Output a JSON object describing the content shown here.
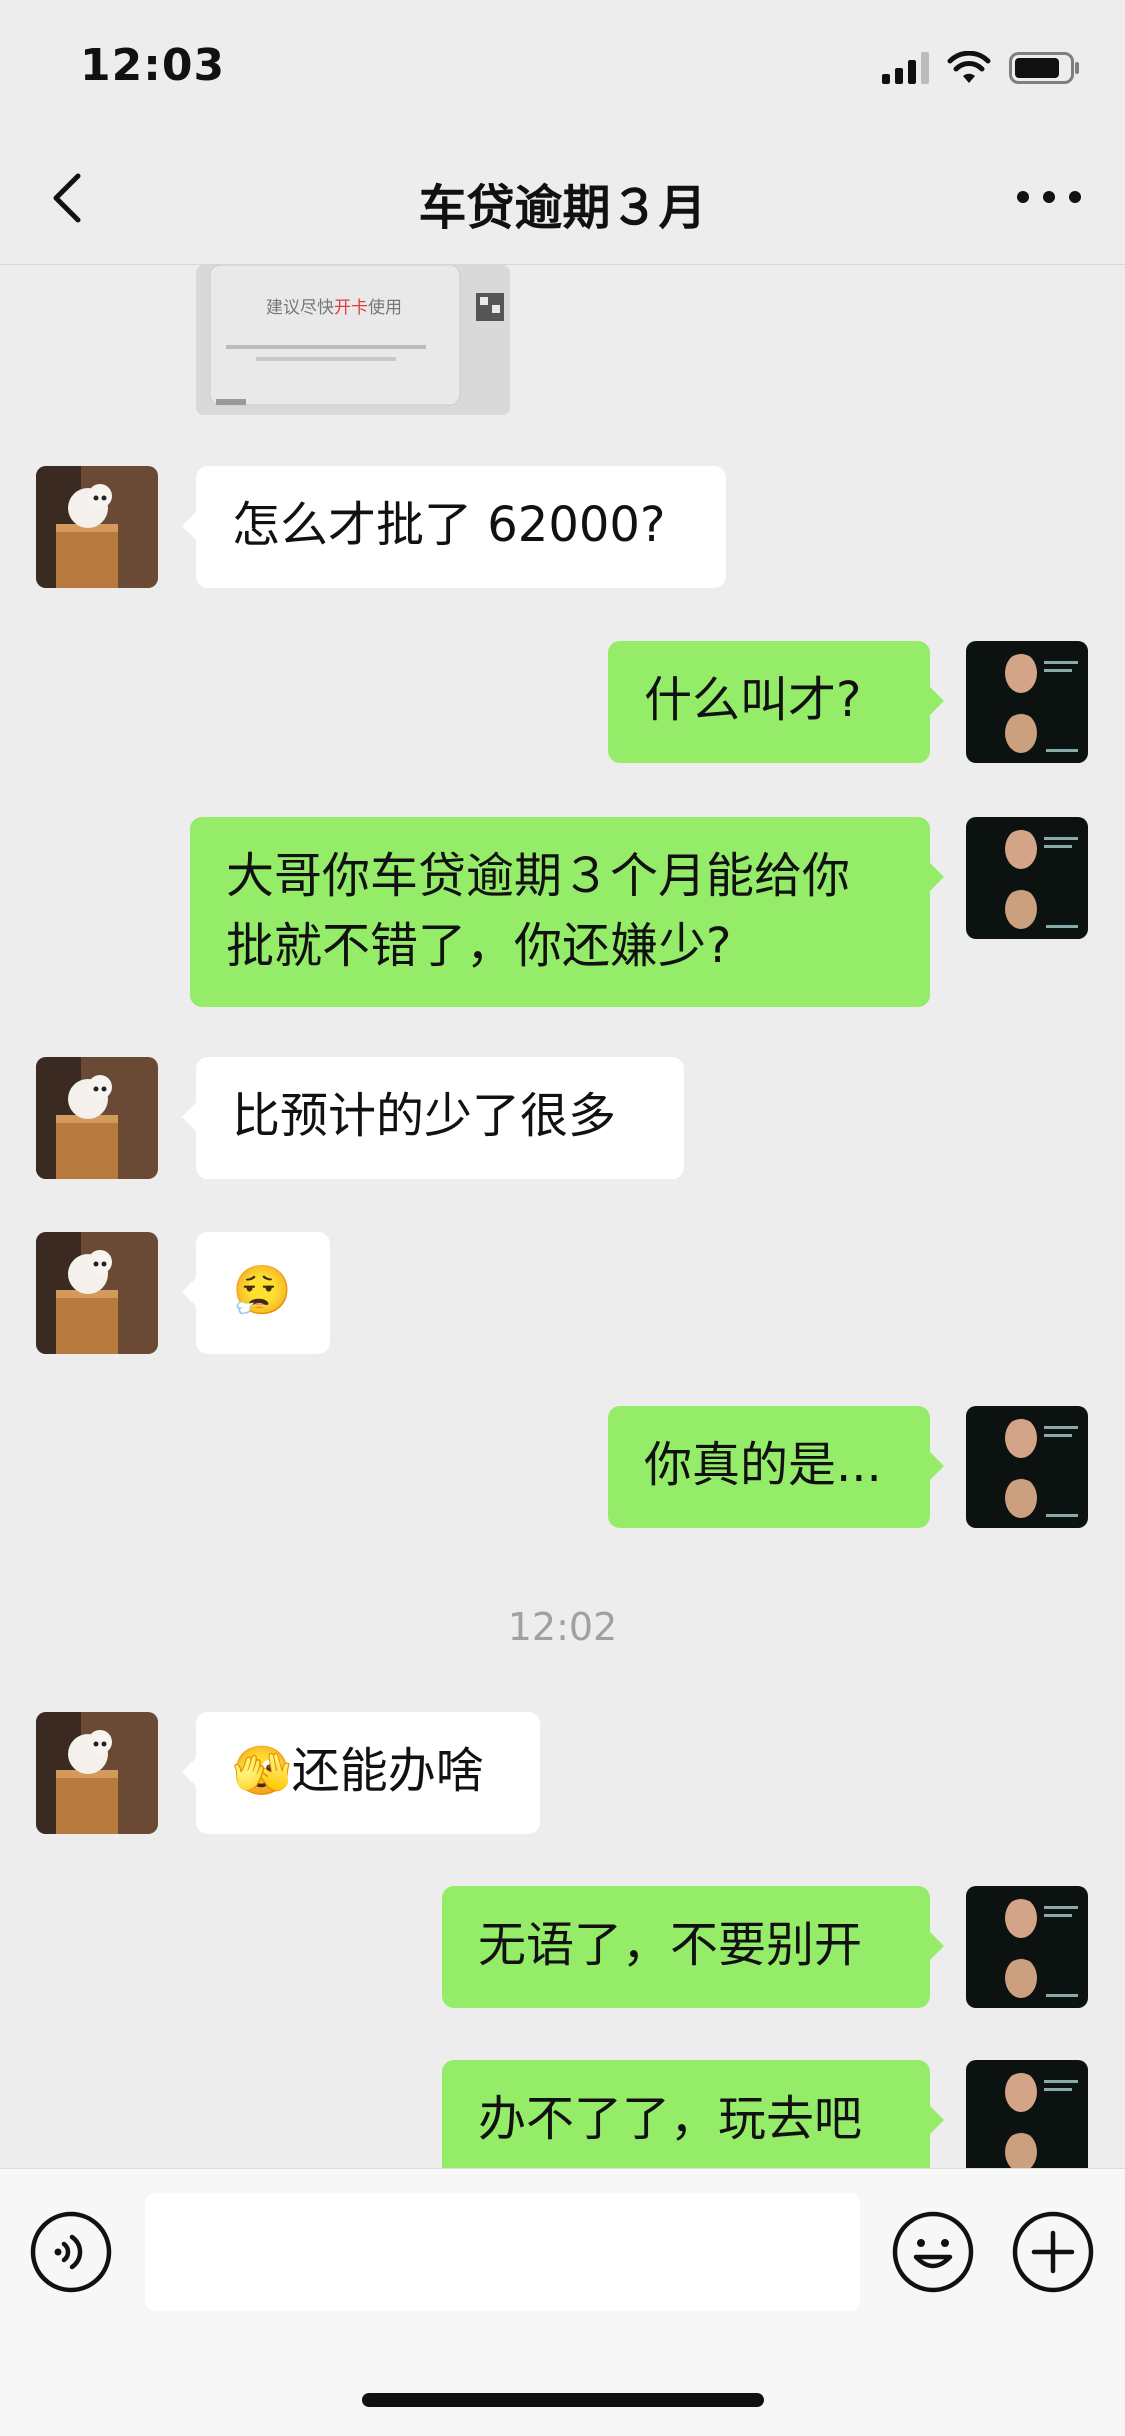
{
  "status": {
    "time": "12:03"
  },
  "nav": {
    "title": "车贷逾期３月"
  },
  "image_message": {
    "caption": "建议尽快",
    "highlight": "开卡",
    "caption_end": "使用"
  },
  "messages": [
    {
      "side": "left",
      "text": "怎么才批了 62000?"
    },
    {
      "side": "right",
      "text": "什么叫才?"
    },
    {
      "side": "right",
      "text": "大哥你车贷逾期３个月能给你批就不错了，你还嫌少?"
    },
    {
      "side": "left",
      "text": "比预计的少了很多"
    },
    {
      "side": "left",
      "text": "😮‍💨"
    },
    {
      "side": "right",
      "text": "你真的是..."
    },
    {
      "side": "left",
      "text": "🫣还能办啥"
    },
    {
      "side": "right",
      "text": "无语了，不要别开"
    },
    {
      "side": "right",
      "text": "办不了了，玩去吧"
    }
  ],
  "timestamp": "12:02",
  "colors": {
    "background": "#ededed",
    "self_bubble": "#95ec69",
    "other_bubble": "#ffffff"
  },
  "icons": {
    "back": "chevron-left-icon",
    "more": "more-dots-icon",
    "voice": "voice-icon",
    "emoji": "emoji-icon",
    "plus": "plus-icon"
  }
}
